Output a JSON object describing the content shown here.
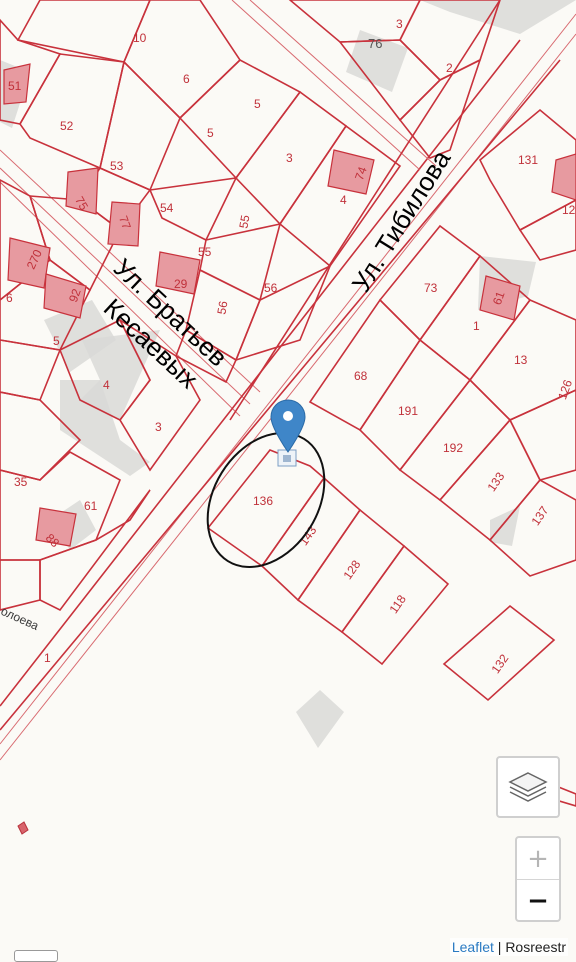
{
  "streets": {
    "bratyev_line1": "Ул. Братьев",
    "bratyev_line2": "Кесаевых",
    "tibilova": "Ул. Тибилова",
    "partial": "олоева"
  },
  "plots": {
    "p10": "10",
    "p3a": "3",
    "p76": "76",
    "p2": "2",
    "p51": "51",
    "p6a": "6",
    "p52": "52",
    "p5a": "5",
    "p5b": "5",
    "p53": "53",
    "p3b": "3",
    "p131": "131",
    "p75": "75",
    "p77": "77",
    "p54": "54",
    "p74": "74",
    "p4a": "4",
    "p12": "12",
    "p270": "270",
    "p55a": "55",
    "p55b": "55",
    "p6b": "6",
    "p92": "92",
    "p29": "29",
    "p56a": "56",
    "p56b": "56",
    "p73": "73",
    "p61a": "61",
    "p5c": "5",
    "p1a": "1",
    "p13": "13",
    "p4b": "4",
    "p68": "68",
    "p126": "126",
    "p191": "191",
    "p3c": "3",
    "p192": "192",
    "p35": "35",
    "p136": "136",
    "p61b": "61",
    "p133": "133",
    "p137": "137",
    "p88": "88",
    "p143": "143",
    "p128": "128",
    "p118": "118",
    "p1b": "1",
    "p132": "132"
  },
  "marker": {
    "icon": "map-pin-icon",
    "color": "#3f86c8"
  },
  "controls": {
    "layers_icon": "layers-icon",
    "zoom_in": "+",
    "zoom_out": "−"
  },
  "attribution": {
    "leaflet": "Leaflet",
    "separator": " | ",
    "source": "Rosreestr"
  }
}
